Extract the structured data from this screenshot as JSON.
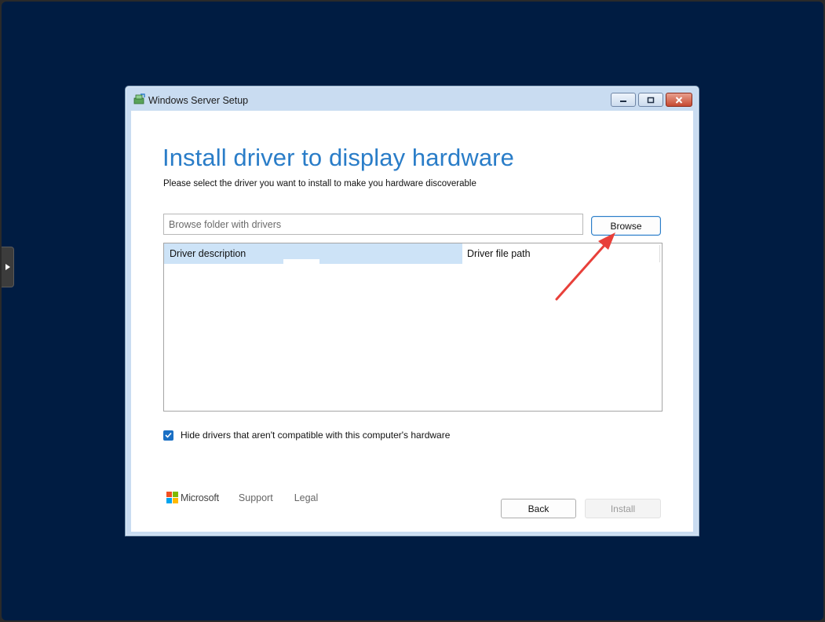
{
  "window": {
    "title": "Windows Server Setup"
  },
  "page": {
    "heading": "Install driver to display hardware",
    "subheading": "Please select the driver you want to install to make you hardware discoverable"
  },
  "path_input": {
    "value": "",
    "placeholder": "Browse folder with drivers"
  },
  "browse_label": "Browse",
  "table": {
    "columns": [
      "Driver description",
      "Driver file path"
    ],
    "rows": []
  },
  "hide_incompatible": {
    "checked": true,
    "label": "Hide drivers that aren't compatible with this computer's hardware"
  },
  "footer": {
    "brand": "Microsoft",
    "links": [
      "Support",
      "Legal"
    ],
    "back_label": "Back",
    "install_label": "Install"
  },
  "colors": {
    "desktop_background": "#001c42",
    "heading": "#2a7dc8",
    "checkbox": "#1a6fc4",
    "annotation_arrow": "#e8403a",
    "ms_red": "#f25022",
    "ms_green": "#7fba00",
    "ms_blue": "#00a4ef",
    "ms_yellow": "#ffb900"
  },
  "icons": [
    "setup-app-icon",
    "minimize-icon",
    "maximize-icon",
    "close-icon",
    "checkmark-icon",
    "expand-arrow-icon",
    "microsoft-logo-icon"
  ]
}
